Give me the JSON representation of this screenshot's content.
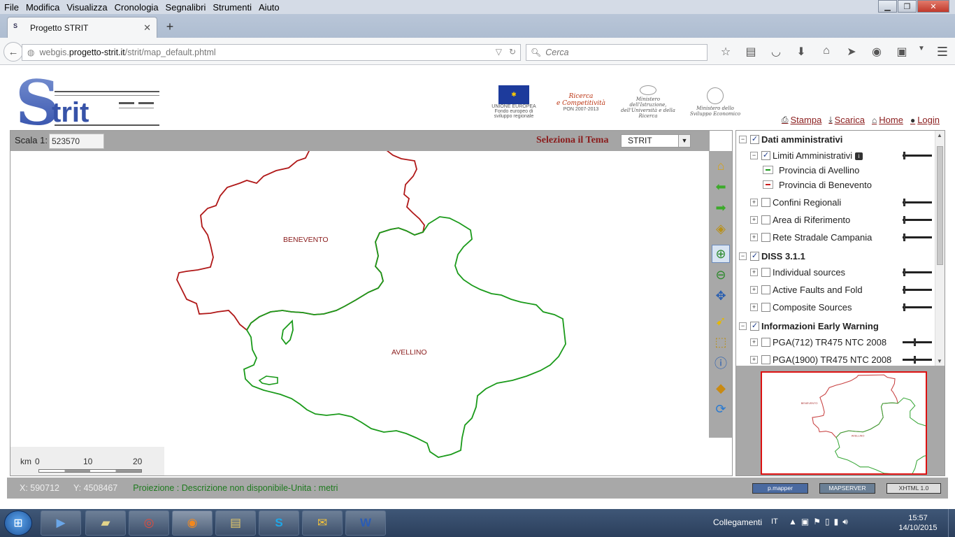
{
  "browser": {
    "menu": [
      "File",
      "Modifica",
      "Visualizza",
      "Cronologia",
      "Segnalibri",
      "Strumenti",
      "Aiuto"
    ],
    "tab_title": "Progetto STRIT",
    "url_host_prefix": "webgis.",
    "url_host": "progetto-strit.it",
    "url_path": "/strit/map_default.phtml",
    "search_placeholder": "Cerca"
  },
  "site": {
    "logo_text": "Strit",
    "partner_logos": [
      {
        "name": "eu-logo",
        "caption": "UNIONE EUROPEA\nFondo europeo di sviluppo regionale"
      },
      {
        "name": "pon-logo",
        "caption": "Ricerca e Competitività\nPON 2007-2013"
      },
      {
        "name": "miur-logo",
        "caption": "Ministero dell'Istruzione, dell'Università e della Ricerca"
      },
      {
        "name": "mise-logo",
        "caption": "Ministero dello Sviluppo Economico"
      }
    ],
    "top_links": {
      "stampa": "Stampa",
      "scarica": "Scarica",
      "home": "Home",
      "login": "Login"
    }
  },
  "map": {
    "scale_label": "Scala 1:",
    "scale_value": "523570",
    "theme_label": "Seleziona il Tema",
    "theme_value": "STRIT",
    "labels": {
      "benevento": "BENEVENTO",
      "avellino": "AVELLINO"
    },
    "scalebar": {
      "unit": "km",
      "ticks": [
        "0",
        "10",
        "20"
      ]
    },
    "colors": {
      "benevento_border": "#b01818",
      "avellino_border": "#1a9a1a"
    }
  },
  "legend": {
    "groups": [
      {
        "label": "Dati amministrativi",
        "checked": true
      },
      {
        "label": "DISS 3.1.1",
        "checked": true
      },
      {
        "label": "Informazioni Early Warning",
        "checked": true
      }
    ],
    "layers": {
      "limiti": "Limiti Amministrativi",
      "prov_avellino": "Provincia di Avellino",
      "prov_benevento": "Provincia di Benevento",
      "confini": "Confini Regionali",
      "area_rif": "Area di Riferimento",
      "rete_stradale": "Rete Stradale Campania",
      "individual": "Individual sources",
      "active_faults": "Active Faults and Fold",
      "composite": "Composite Sources",
      "pga712": "PGA(712) TR475 NTC 2008",
      "pga1900": "PGA(1900) TR475 NTC 2008"
    }
  },
  "status": {
    "x": "X: 590712",
    "y": "Y: 4508467",
    "projection": "Proiezione : Descrizione non disponibile-Unita : metri",
    "badges": [
      "p.mapper",
      "MAPSERVER",
      "XHTML 1.0"
    ]
  },
  "taskbar": {
    "apps": [
      "media-player",
      "libraries",
      "chrome",
      "firefox",
      "file-explorer",
      "skype",
      "outlook",
      "word"
    ],
    "tray_label": "Collegamenti",
    "lang": "IT",
    "time": "15:57",
    "date": "14/10/2015"
  }
}
